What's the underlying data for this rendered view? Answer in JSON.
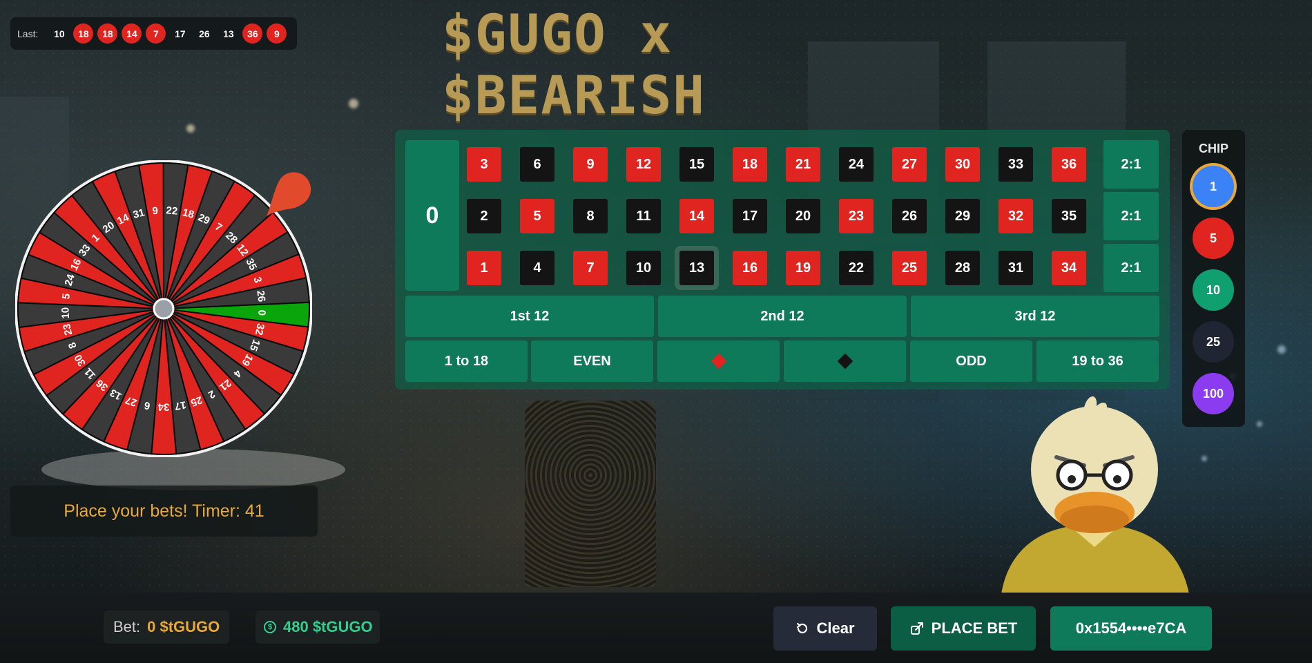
{
  "title": "$GUGO x $BEARISH",
  "last_results": {
    "label": "Last:",
    "numbers": [
      {
        "value": "10",
        "color": "black"
      },
      {
        "value": "18",
        "color": "red"
      },
      {
        "value": "18",
        "color": "red"
      },
      {
        "value": "14",
        "color": "red"
      },
      {
        "value": "7",
        "color": "red"
      },
      {
        "value": "17",
        "color": "black"
      },
      {
        "value": "26",
        "color": "black"
      },
      {
        "value": "13",
        "color": "black"
      },
      {
        "value": "36",
        "color": "red"
      },
      {
        "value": "9",
        "color": "red"
      }
    ]
  },
  "wheel": {
    "sequence": [
      "0",
      "32",
      "15",
      "19",
      "4",
      "21",
      "2",
      "25",
      "17",
      "34",
      "6",
      "27",
      "13",
      "36",
      "11",
      "30",
      "8",
      "23",
      "10",
      "5",
      "24",
      "16",
      "33",
      "1",
      "20",
      "14",
      "31",
      "9",
      "22",
      "18",
      "29",
      "7",
      "28",
      "12",
      "35",
      "3",
      "26"
    ],
    "colors": {
      "red": "#e0241f",
      "black": "#3a3a3a",
      "green": "#0aa50a"
    }
  },
  "status": {
    "text": "Place your bets! Timer: 41"
  },
  "board": {
    "zero": "0",
    "grid": [
      [
        "3",
        "6",
        "9",
        "12",
        "15",
        "18",
        "21",
        "24",
        "27",
        "30",
        "33",
        "36"
      ],
      [
        "2",
        "5",
        "8",
        "11",
        "14",
        "17",
        "20",
        "23",
        "26",
        "29",
        "32",
        "35"
      ],
      [
        "1",
        "4",
        "7",
        "10",
        "13",
        "16",
        "19",
        "22",
        "25",
        "28",
        "31",
        "34"
      ]
    ],
    "red_numbers": [
      "1",
      "3",
      "5",
      "7",
      "9",
      "12",
      "14",
      "16",
      "18",
      "19",
      "21",
      "23",
      "25",
      "27",
      "30",
      "32",
      "34",
      "36"
    ],
    "highlighted": "13",
    "column_bets": [
      "2:1",
      "2:1",
      "2:1"
    ],
    "dozens": [
      "1st 12",
      "2nd 12",
      "3rd 12"
    ],
    "outside": {
      "low": "1 to 18",
      "even": "EVEN",
      "odd": "ODD",
      "high": "19 to 36"
    },
    "colors": {
      "red": "#e0241f",
      "black": "#141414",
      "felt": "#0e7a5a"
    }
  },
  "chips": {
    "title": "CHIP",
    "items": [
      {
        "value": "1",
        "color": "#3b82f6",
        "selected": true
      },
      {
        "value": "5",
        "color": "#e0241f",
        "selected": false
      },
      {
        "value": "10",
        "color": "#10a070",
        "selected": false
      },
      {
        "value": "25",
        "color": "#1f2533",
        "selected": false
      },
      {
        "value": "100",
        "color": "#8b3cf0",
        "selected": false
      }
    ],
    "selected_ring": "#e8a93a"
  },
  "footer": {
    "bet_label": "Bet:",
    "bet_value": "0 $tGUGO",
    "coin_symbol": "$",
    "balance": "480 $tGUGO",
    "clear_label": "Clear",
    "place_bet_label": "PLACE BET",
    "wallet": "0x1554••••e7CA"
  }
}
